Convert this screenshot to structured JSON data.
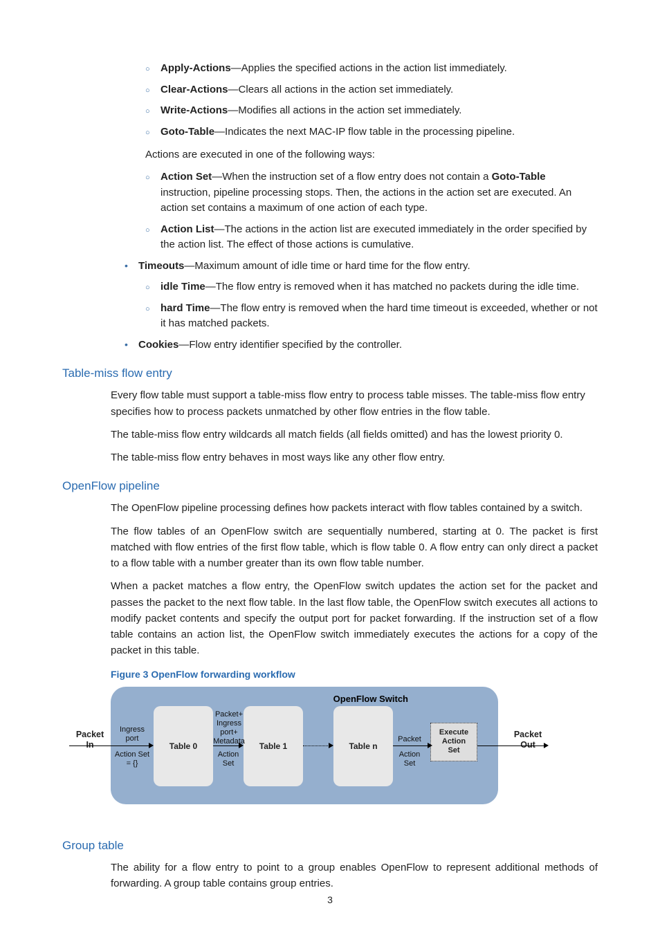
{
  "actions": [
    {
      "name": "Apply-Actions",
      "desc": "—Applies the specified actions in the action list immediately."
    },
    {
      "name": "Clear-Actions",
      "desc": "—Clears all actions in the action set immediately."
    },
    {
      "name": "Write-Actions",
      "desc": "—Modifies all actions in the action set immediately."
    },
    {
      "name": "Goto-Table",
      "desc": "—Indicates the next MAC-IP flow table in the processing pipeline."
    }
  ],
  "exec_intro": "Actions are executed in one of the following ways:",
  "exec": [
    {
      "name": "Action Set",
      "desc_pre": "—When the instruction set of a flow entry does not contain a ",
      "desc_mid": "Goto-Table",
      "desc_post": " instruction, pipeline processing stops. Then, the actions in the action set are executed. An action set contains a maximum of one action of each type."
    },
    {
      "name": "Action List",
      "desc": "—The actions in the action list are executed immediately in the order specified by the action list. The effect of those actions is cumulative."
    }
  ],
  "timeouts": {
    "name": "Timeouts",
    "desc": "—Maximum amount of idle time or hard time for the flow entry.",
    "items": [
      {
        "name": "idle Time",
        "desc": "—The flow entry is removed when it has matched no packets during the idle time."
      },
      {
        "name": "hard Time",
        "desc": "—The flow entry is removed when the hard time timeout is exceeded, whether or not it has matched packets."
      }
    ]
  },
  "cookies": {
    "name": "Cookies",
    "desc": "—Flow entry identifier specified by the controller."
  },
  "sections": {
    "tablemiss": {
      "title": "Table-miss flow entry",
      "p1": "Every flow table must support a table-miss flow entry to process table misses. The table-miss flow entry specifies how to process packets unmatched by other flow entries in the flow table.",
      "p2": "The table-miss flow entry wildcards all match fields (all fields omitted) and has the lowest priority 0.",
      "p3": "The table-miss flow entry behaves in most ways like any other flow entry."
    },
    "pipeline": {
      "title": "OpenFlow pipeline",
      "p1": "The OpenFlow pipeline processing defines how packets interact with flow tables contained by a switch.",
      "p2": "The flow tables of an OpenFlow switch are sequentially numbered, starting at 0. The packet is first matched with flow entries of the first flow table, which is flow table 0. A flow entry can only direct a packet to a flow table with a number greater than its own flow table number.",
      "p3": "When a packet matches a flow entry, the OpenFlow switch updates the action set for the packet and passes the packet to the next flow table. In the last flow table, the OpenFlow switch executes all actions to modify packet contents and specify the output port for packet forwarding. If the instruction set of a flow table contains an action list, the OpenFlow switch immediately executes the actions for a copy of the packet in this table."
    },
    "group": {
      "title": "Group table",
      "p1": "The ability for a flow entry to point to a group enables OpenFlow to represent additional methods of forwarding. A group table contains group entries."
    }
  },
  "figure": {
    "caption": "Figure 3 OpenFlow forwarding workflow",
    "ofs": "OpenFlow Switch",
    "packet_in": "Packet In",
    "packet_out": "Packet Out",
    "t0": "Table 0",
    "t1": "Table 1",
    "tn": "Table n",
    "ingress_port": "Ingress port",
    "action_set_empty": "Action Set = {}",
    "packet_plus": "Packet+ Ingress port+ Metadata",
    "action_set": "Action Set",
    "packet": "Packet",
    "exec1": "Execute",
    "exec2": "Action",
    "exec3": "Set"
  },
  "pagenum": "3"
}
